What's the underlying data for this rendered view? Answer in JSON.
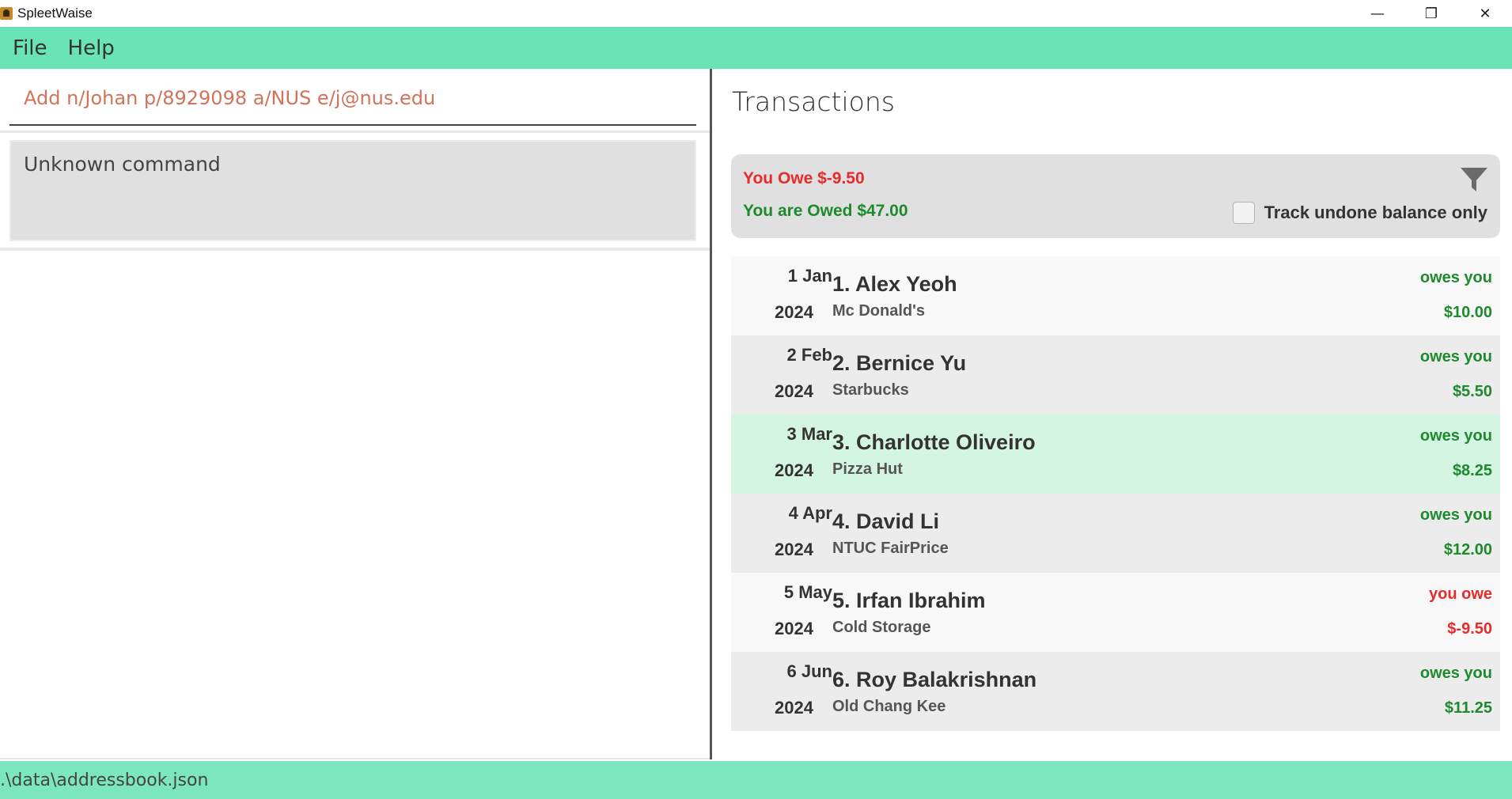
{
  "window": {
    "title": "SpleetWaise",
    "minimize_glyph": "—",
    "restore_glyph": "❐",
    "close_glyph": "✕"
  },
  "menu": {
    "items": [
      "File",
      "Help"
    ]
  },
  "command": {
    "value": "Add n/Johan p/8929098 a/NUS e/j@nus.edu"
  },
  "result": {
    "text": "Unknown command"
  },
  "transactions": {
    "heading": "Transactions",
    "you_owe": "You Owe $-9.50",
    "you_are_owed": "You are Owed $47.00",
    "track_label": "Track undone balance only",
    "track_checked": false,
    "filter_icon": "filter-icon",
    "colors": {
      "owes_you": "#1e8a2e",
      "you_owe": "#e52b2b",
      "selected_row": "#d5f5e3",
      "accent": "#6ae3b7"
    },
    "rows": [
      {
        "day": "1 Jan",
        "year": "2024",
        "name": "1. Alex Yeoh",
        "place": "Mc Donald's",
        "status": "owes you",
        "amount": "$10.00",
        "kind": "owes_you"
      },
      {
        "day": "2 Feb",
        "year": "2024",
        "name": "2. Bernice Yu",
        "place": "Starbucks",
        "status": "owes you",
        "amount": "$5.50",
        "kind": "owes_you"
      },
      {
        "day": "3 Mar",
        "year": "2024",
        "name": "3. Charlotte Oliveiro",
        "place": "Pizza Hut",
        "status": "owes you",
        "amount": "$8.25",
        "kind": "owes_you",
        "selected": true
      },
      {
        "day": "4 Apr",
        "year": "2024",
        "name": "4. David Li",
        "place": "NTUC FairPrice",
        "status": "owes you",
        "amount": "$12.00",
        "kind": "owes_you"
      },
      {
        "day": "5 May",
        "year": "2024",
        "name": "5. Irfan Ibrahim",
        "place": "Cold Storage",
        "status": "you owe",
        "amount": "$-9.50",
        "kind": "you_owe"
      },
      {
        "day": "6 Jun",
        "year": "2024",
        "name": "6. Roy Balakrishnan",
        "place": "Old Chang Kee",
        "status": "owes you",
        "amount": "$11.25",
        "kind": "owes_you"
      }
    ]
  },
  "status_bar": {
    "path": ".\\data\\addressbook.json"
  }
}
